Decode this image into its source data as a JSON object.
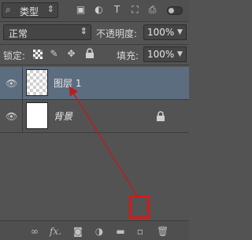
{
  "filter": {
    "label": "类型",
    "icon": "search-icon"
  },
  "blend": {
    "mode": "正常"
  },
  "opacity": {
    "label": "不透明度:",
    "value": "100%"
  },
  "lock": {
    "label": "锁定:"
  },
  "fill": {
    "label": "填充:",
    "value": "100%"
  },
  "layers": [
    {
      "name": "图层 1",
      "selected": true,
      "thumbnail": "transparent",
      "visible": true,
      "locked": false
    },
    {
      "name": "背景",
      "selected": false,
      "thumbnail": "white",
      "visible": true,
      "locked": true
    }
  ],
  "bottom_icons": [
    "link-icon",
    "fx-icon",
    "mask-icon",
    "adjustment-icon",
    "folder-icon",
    "new-layer-icon",
    "trash-icon"
  ],
  "bottom_labels": {
    "fx": "fx."
  },
  "colors": {
    "panel": "#535353",
    "selected_layer": "#5d6d80",
    "highlight": "#d81818",
    "arrow": "#b81e1e"
  }
}
